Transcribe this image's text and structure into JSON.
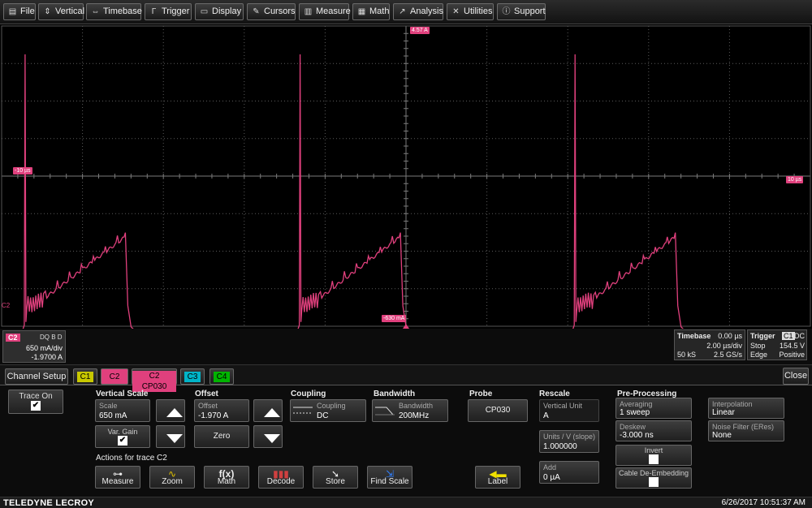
{
  "menu": [
    {
      "label": "File",
      "icon": "file-icon"
    },
    {
      "label": "Vertical",
      "icon": "vertical-arrow-icon"
    },
    {
      "label": "Timebase",
      "icon": "horizontal-arrow-icon"
    },
    {
      "label": "Trigger",
      "icon": "trigger-icon"
    },
    {
      "label": "Display",
      "icon": "display-icon"
    },
    {
      "label": "Cursors",
      "icon": "cursor-icon"
    },
    {
      "label": "Measure",
      "icon": "measure-icon"
    },
    {
      "label": "Math",
      "icon": "math-icon"
    },
    {
      "label": "Analysis",
      "icon": "analysis-icon"
    },
    {
      "label": "Utilities",
      "icon": "wrench-icon"
    },
    {
      "label": "Support",
      "icon": "info-icon"
    }
  ],
  "markers": {
    "top": "4.57 A",
    "left": "-10 µs",
    "right": "10 µs",
    "bottom": "-630 mA",
    "channel": "C2"
  },
  "trace_color": "#e0407d",
  "trace": {
    "period_divs": 3.4,
    "pulse_starts": [
      0.2,
      3.6,
      7.0
    ],
    "pulse_width_divs": 1.25
  },
  "channel_info": {
    "name": "C2",
    "flags": "DQ B D",
    "scale": "650 mA/div",
    "offset": "-1.9700 A"
  },
  "timebase": {
    "title": "Timebase",
    "delay": "0.00 µs",
    "per_div": "2.00 µs/div",
    "samples": "50 kS",
    "rate": "2.5 GS/s"
  },
  "trigger": {
    "title": "Trigger",
    "source": "C1",
    "coupling": "DC",
    "mode": "Stop",
    "level": "154.5 V",
    "type": "Edge",
    "slope": "Positive"
  },
  "tabs": {
    "setup": "Channel Setup",
    "c1": "C1",
    "c2": "C2",
    "c2probe": "C2 CP030",
    "c3": "C3",
    "c4": "C4",
    "close": "Close"
  },
  "colors": {
    "c1": "#c8c800",
    "c2": "#e0407d",
    "c3": "#00b4c8",
    "c4": "#00b400"
  },
  "trace_on": {
    "label": "Trace On",
    "checked": true
  },
  "vertical": {
    "header": "Vertical Scale",
    "scale_label": "Scale",
    "scale_value": "650 mA",
    "var_gain_label": "Var. Gain",
    "var_gain_checked": true
  },
  "offset": {
    "header": "Offset",
    "label": "Offset",
    "value": "-1.970 A",
    "zero": "Zero"
  },
  "coupling": {
    "header": "Coupling",
    "label": "Coupling",
    "value": "DC"
  },
  "bandwidth": {
    "header": "Bandwidth",
    "label": "Bandwidth",
    "value": "200MHz"
  },
  "probe": {
    "header": "Probe",
    "value": "CP030"
  },
  "rescale": {
    "header": "Rescale",
    "vunit_label": "Vertical Unit",
    "vunit_value": "A",
    "units_label": "Units / V (slope)",
    "units_value": "1.000000",
    "add_label": "Add",
    "add_value": "0 µA"
  },
  "preproc": {
    "header": "Pre-Processing",
    "avg_label": "Averaging",
    "avg_value": "1 sweep",
    "deskew_label": "Deskew",
    "deskew_value": "-3.000 ns",
    "invert": "Invert",
    "cable": "Cable De-Embedding",
    "interp_label": "Interpolation",
    "interp_value": "Linear",
    "noise_label": "Noise Filter (ERes)",
    "noise_value": "None"
  },
  "actions": {
    "header": "Actions for trace C2",
    "measure": "Measure",
    "zoom": "Zoom",
    "math": "Math",
    "decode": "Decode",
    "store": "Store",
    "find_scale": "Find Scale",
    "label": "Label"
  },
  "footer": {
    "brand": "TELEDYNE LECROY",
    "datetime": "6/26/2017 10:51:37 AM"
  }
}
